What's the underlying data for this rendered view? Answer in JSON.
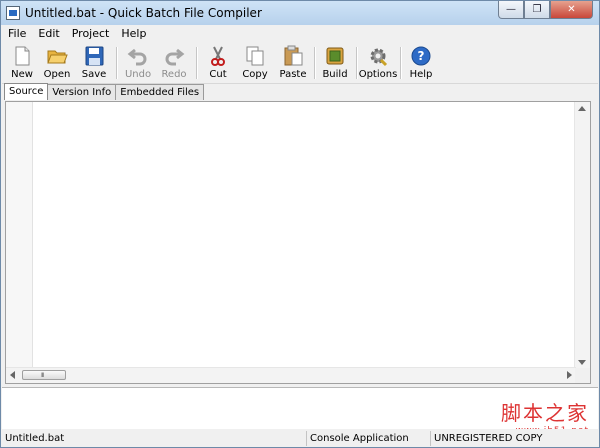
{
  "window": {
    "title": "Untitled.bat - Quick Batch File Compiler"
  },
  "menu": [
    "File",
    "Edit",
    "Project",
    "Help"
  ],
  "toolbar": {
    "new": "New",
    "open": "Open",
    "save": "Save",
    "undo": "Undo",
    "redo": "Redo",
    "cut": "Cut",
    "copy": "Copy",
    "paste": "Paste",
    "build": "Build",
    "options": "Options",
    "help": "Help"
  },
  "tabs": [
    "Source",
    "Version Info",
    "Embedded Files"
  ],
  "scrollbar": {
    "grip": "III"
  },
  "status": {
    "file": "Untitled.bat",
    "type": "Console Application",
    "license": "UNREGISTERED COPY"
  },
  "watermark": {
    "text": "脚本之家",
    "url": "www.jb51.net"
  }
}
